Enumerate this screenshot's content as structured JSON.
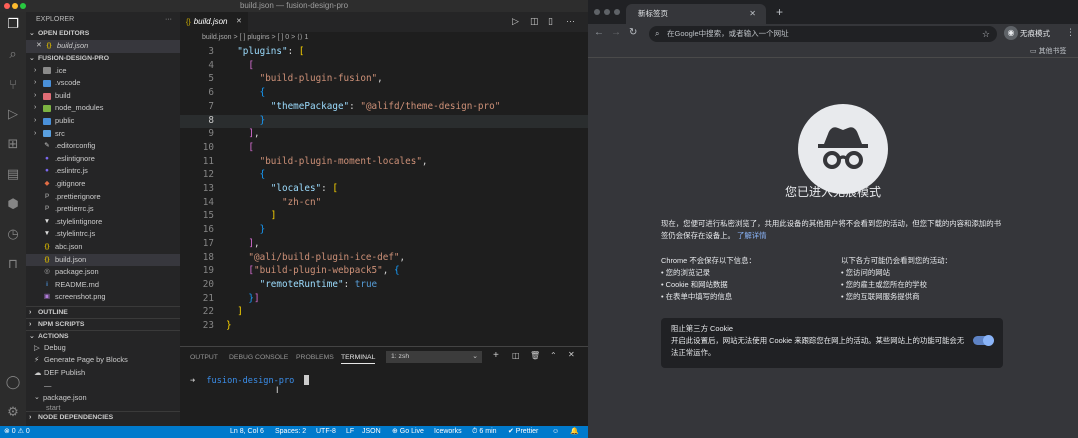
{
  "vscode": {
    "title": "build.json — fusion-design-pro",
    "explorer_label": "EXPLORER",
    "open_editors_label": "OPEN EDITORS",
    "open_editor_file": "build.json",
    "project_label": "FUSION-DESIGN-PRO",
    "tree": [
      {
        "name": ".ice",
        "kind": "folder",
        "color": "#8a8a8a"
      },
      {
        "name": ".vscode",
        "kind": "folder",
        "color": "#4a90d9"
      },
      {
        "name": "build",
        "kind": "folder",
        "color": "#e06c75"
      },
      {
        "name": "node_modules",
        "kind": "folder",
        "color": "#7cb342"
      },
      {
        "name": "public",
        "kind": "folder",
        "color": "#4a90d9"
      },
      {
        "name": "src",
        "kind": "folder",
        "color": "#5aa0e0"
      },
      {
        "name": ".editorconfig",
        "kind": "file",
        "glyph": "✎",
        "color": "#cccccc"
      },
      {
        "name": ".eslintignore",
        "kind": "file",
        "glyph": "●",
        "color": "#7b68ee"
      },
      {
        "name": ".eslintrc.js",
        "kind": "file",
        "glyph": "●",
        "color": "#7b68ee"
      },
      {
        "name": ".gitignore",
        "kind": "file",
        "glyph": "◆",
        "color": "#e06c45"
      },
      {
        "name": ".prettierignore",
        "kind": "file",
        "glyph": "P",
        "color": "#888"
      },
      {
        "name": ".prettierrc.js",
        "kind": "file",
        "glyph": "P",
        "color": "#888"
      },
      {
        "name": ".stylelintignore",
        "kind": "file",
        "glyph": "▼",
        "color": "#dddddd"
      },
      {
        "name": ".stylelintrc.js",
        "kind": "file",
        "glyph": "▼",
        "color": "#dddddd"
      },
      {
        "name": "abc.json",
        "kind": "file",
        "glyph": "{}",
        "color": "#d4b400"
      },
      {
        "name": "build.json",
        "kind": "file",
        "glyph": "{}",
        "color": "#d4b400",
        "selected": true
      },
      {
        "name": "package.json",
        "kind": "file",
        "glyph": "◎",
        "color": "#aaa"
      },
      {
        "name": "README.md",
        "kind": "file",
        "glyph": "i",
        "color": "#4a90d9"
      },
      {
        "name": "screenshot.png",
        "kind": "file",
        "glyph": "▣",
        "color": "#b07cd8"
      }
    ],
    "outline_label": "OUTLINE",
    "npm_label": "NPM SCRIPTS",
    "actions_label": "ACTIONS",
    "actions": [
      "Debug",
      "Generate Page by Blocks",
      "DEF Publish",
      "—"
    ],
    "package_json_label": "package.json",
    "start_label": "start",
    "node_deps_label": "NODE DEPENDENCIES",
    "tab_label": "build.json",
    "breadcrumb": "build.json > [ ] plugins > [ ] 0 > ⟨⟩ 1",
    "code_lines": [
      {
        "n": "3",
        "html": "  <span class='k'>\"plugins\"</span>: <span class='b'>[</span>"
      },
      {
        "n": "4",
        "html": "    <span class='p'>[</span>"
      },
      {
        "n": "5",
        "html": "      <span class='s'>\"build-plugin-fusion\"</span>,"
      },
      {
        "n": "6",
        "html": "      <span class='bl'>{</span>"
      },
      {
        "n": "7",
        "html": "        <span class='k'>\"themePackage\"</span>: <span class='s'>\"@alifd/theme-design-pro\"</span>"
      },
      {
        "n": "8",
        "html": "      <span class='bl'>}</span>"
      },
      {
        "n": "9",
        "html": "    <span class='p'>]</span>,"
      },
      {
        "n": "10",
        "html": "    <span class='p'>[</span>"
      },
      {
        "n": "11",
        "html": "      <span class='s'>\"build-plugin-moment-locales\"</span>,"
      },
      {
        "n": "12",
        "html": "      <span class='bl'>{</span>"
      },
      {
        "n": "13",
        "html": "        <span class='k'>\"locales\"</span>: <span class='b'>[</span>"
      },
      {
        "n": "14",
        "html": "          <span class='s'>\"zh-cn\"</span>"
      },
      {
        "n": "15",
        "html": "        <span class='b'>]</span>"
      },
      {
        "n": "16",
        "html": "      <span class='bl'>}</span>"
      },
      {
        "n": "17",
        "html": "    <span class='p'>]</span>,"
      },
      {
        "n": "18",
        "html": "    <span class='s'>\"@ali/build-plugin-ice-def\"</span>,"
      },
      {
        "n": "19",
        "html": "    <span class='p'>[</span><span class='s'>\"build-plugin-webpack5\"</span>, <span class='bl'>{</span>"
      },
      {
        "n": "20",
        "html": "      <span class='k'>\"remoteRuntime\"</span>: <span class='kw'>true</span>"
      },
      {
        "n": "21",
        "html": "    <span class='bl'>}</span><span class='p'>]</span>"
      },
      {
        "n": "22",
        "html": "  <span class='b'>]</span>"
      },
      {
        "n": "23",
        "html": "<span class='b'>}</span>"
      }
    ],
    "panel_tabs": [
      "OUTPUT",
      "DEBUG CONSOLE",
      "PROBLEMS",
      "TERMINAL"
    ],
    "terminal_select": "1: zsh",
    "terminal_prompt": "➜",
    "terminal_dir": "fusion-design-pro",
    "status": {
      "errors": "⊗ 0 ⚠ 0",
      "ln": "Ln 8, Col 6",
      "spaces": "Spaces: 2",
      "enc": "UTF-8",
      "eol": "LF",
      "lang": "JSON",
      "golive": "⊕ Go Live",
      "iceworks": "Iceworks",
      "time": "⏱ 6 min",
      "prettier": "✔ Prettier"
    }
  },
  "chrome": {
    "tab_title": "新标签页",
    "address_placeholder": "在Google中搜索，或者输入一个网址",
    "profile_label": "无痕模式",
    "bookmarks_label": "其他书签",
    "heading": "您已进入无痕模式",
    "intro": "现在，您便可进行私密浏览了，共用此设备的其他用户将不会看到您的活动，但您下载的内容和添加的书签仍会保存在设备上。",
    "learn_more": "了解详情",
    "not_saved_title": "Chrome 不会保存以下信息：",
    "not_saved": [
      "您的浏览记录",
      "Cookie 和网站数据",
      "在表单中填写的信息"
    ],
    "visible_title": "以下各方可能仍会看到您的活动：",
    "visible": [
      "您访问的网站",
      "您的雇主或您所在的学校",
      "您的互联网服务提供商"
    ],
    "cookie_title": "阻止第三方 Cookie",
    "cookie_desc": "开启此设置后，网站无法使用 Cookie 来跟踪您在网上的活动。某些网站上的功能可能会无法正常运作。",
    "accent": "#8ab4f8"
  }
}
